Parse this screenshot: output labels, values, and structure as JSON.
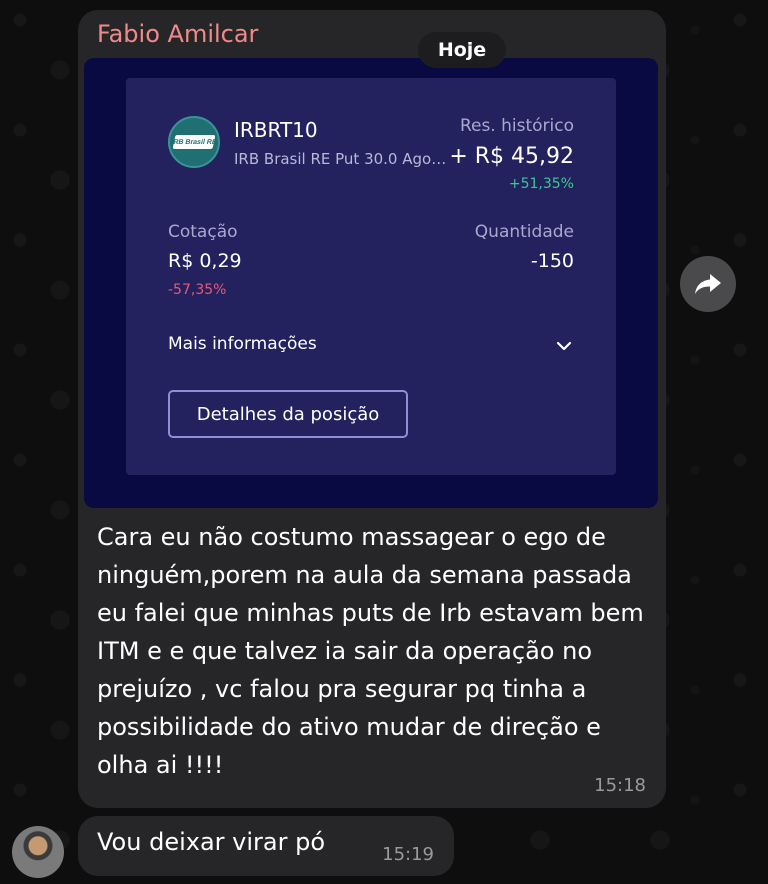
{
  "chat": {
    "sender_name": "Fabio Amilcar",
    "date_label": "Hoje"
  },
  "position_card": {
    "ticker": "IRBRT10",
    "subtitle": "IRB Brasil RE Put 30.0 Ago/...",
    "logo_text": "IRB Brasil RE",
    "result_label": "Res. histórico",
    "result_value": "+ R$ 45,92",
    "result_pct": "+51,35%",
    "quote_label": "Cotação",
    "quote_value": "R$ 0,29",
    "quote_pct": "-57,35%",
    "quantity_label": "Quantidade",
    "quantity_value": "-150",
    "more_info_label": "Mais informações",
    "details_button": "Detalhes da posição"
  },
  "messages": [
    {
      "text": "Cara eu não costumo massagear o ego de ninguém,porem na aula da semana passada eu falei que minhas puts de Irb estavam bem ITM e e que talvez ia sair da operação no prejuízo , vc falou pra segurar pq tinha a possibilidade do ativo mudar de direção e olha ai !!!!",
      "time": "15:18"
    },
    {
      "text": "Vou deixar virar pó",
      "time": "15:19"
    }
  ],
  "colors": {
    "sender": "#ef8a8a",
    "positive": "#3cc98f",
    "negative": "#e85a78",
    "bubble": "#262628",
    "card_bg": "#23225e"
  },
  "icons": [
    "chevron-down-icon",
    "share-forward-icon"
  ]
}
